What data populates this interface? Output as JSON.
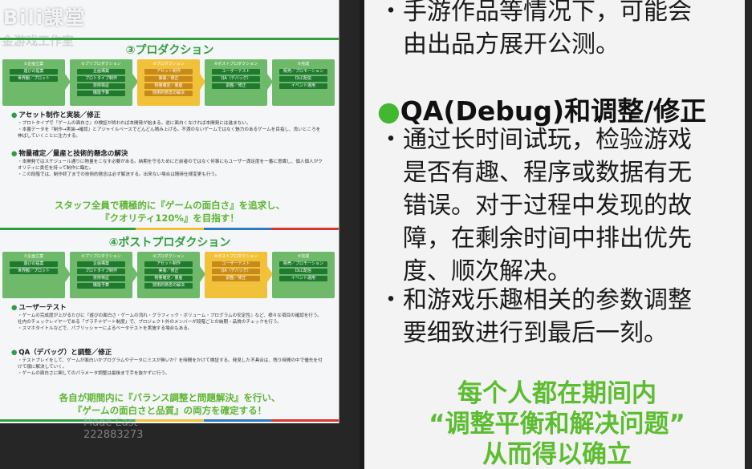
{
  "left_panel": {
    "watermark": "Bili課堂",
    "studio": "金游戏工作室",
    "section3": {
      "title": "③プロダクション",
      "stages": [
        {
          "header": "①企画立案",
          "pills": [
            "遊びの提案",
            "世界観／プロット"
          ]
        },
        {
          "header": "②プリプロダクション",
          "pills": [
            "企画構築",
            "プロトタイプ制作",
            "技術検証",
            "機能予算"
          ]
        },
        {
          "header": "③プロダクション",
          "pills": [
            "アセット制作",
            "実装／修正",
            "物量確定／量産",
            "技術的懸念の解決"
          ]
        },
        {
          "header": "④ポストプロダクション",
          "pills": [
            "ユーザーテスト",
            "QA（デバッグ）",
            "調整／修正"
          ]
        },
        {
          "header": "⑤完成",
          "pills": [
            "販売／プロモーション",
            "DLC配信",
            "イベント運用"
          ]
        }
      ],
      "h1": "アセット制作と実装／修正",
      "p1": [
        "プロトタイプで『ゲームの面白さ』の検証が終われば本開発が始まる。逆に面白くなければ本開発には進まない。",
        "本番データを『制作→実装→確認』とアジャイルベースでどんどん積み上げる。不満のないゲームではなく魅力のあるゲームを目指し、良いところを伸ばしていくことに注力する。"
      ],
      "h2": "物量確定／量産と技術的懸念の解決",
      "p2": [
        "本開発ではスケジュール通りに物量をこなす必要がある。納期を守るためにだ前者のではなく何事にもユーザー満足度を一番に意識し、個人個人がクオリティに責任を持って制作に臨む。",
        "この段階では、制作終了までの技術的懸念は必ず解決する。出来ない場合は随時仕様変更も行う。"
      ],
      "slogan_line1": "スタッフ全員で積極的に『ゲームの面白さ』を追求し、",
      "slogan_line2": "『クオリティ120%』を目指す！"
    },
    "section4": {
      "title": "④ポストプロダクション",
      "stages": [
        {
          "header": "①企画立案",
          "pills": [
            "遊びの提案",
            "世界観／プロット"
          ]
        },
        {
          "header": "②プリプロダクション",
          "pills": [
            "企画構築",
            "プロトタイプ制作",
            "技術検証",
            "機能予算"
          ]
        },
        {
          "header": "③プロダクション",
          "pills": [
            "アセット制作",
            "実装／修正",
            "物量確定／量産",
            "技術的懸念の解決"
          ]
        },
        {
          "header": "④ポストプロダクション",
          "pills": [
            "ユーザーテスト",
            "QA（デバッグ）",
            "調整／修正"
          ]
        },
        {
          "header": "⑤完成",
          "pills": [
            "販売／プロモーション",
            "DLC配信",
            "イベント運用"
          ]
        }
      ],
      "h1": "ユーザーテスト",
      "p1": [
        "ゲームの完成度が上がるたびに『遊びの面白さ・ゲームの流れ・グラフィック・ボリューム・プログラムの安定性』など、様々な項目の確認を行う。社内のチェックレイヤーである『プラチナゲート制度』で、プロジェクト外のメンバーが段階ごとの納期・品質のチェックを行う。",
        "スマホタイトルなどで、パブリッシャーによるベータテストを実施する場合もある。"
      ],
      "h2": "QA（デバッグ）と調整／修正",
      "p2": [
        "テストプレイをして、ゲームが面白いかプログラムやデータにミスが無いか？を時間をかけて検証する。発見した不具合は、残り時間の中で優先を付けて順に解決していく。",
        "ゲームの面白さに関してのパラメータ調整は最後まで手を抜かずに行う。"
      ],
      "slogan_line1": "各自が期間内に『バランス調整と問題解決』を行い、",
      "slogan_line2": "『ゲームの面白さと品質』の両方を確定する！"
    },
    "overlay_text": "Made East",
    "overlay_id": "222883273"
  },
  "right_panel": {
    "bullet0": [
      "手游作品等情况下，可能会",
      "由出品方展开公测。"
    ],
    "heading_mark": "●",
    "heading": "QA(Debug)和调整/修正",
    "bullet1": [
      "通过长时间试玩，检验游戏",
      "是否有趣、程序或数据有无",
      "错误。对于过程中发现的故",
      "障，在剩余时间中排出优先",
      "度、顺次解决。"
    ],
    "bullet2": [
      "和游戏乐趣相关的参数调整",
      "要细致进行到最后一刻。"
    ],
    "bullet_mark": "・",
    "slogan": [
      "每个人都在期间内",
      "“调整平衡和解决问题”",
      "从而得以确立"
    ]
  },
  "colors": {
    "green": "#2f9e3f",
    "yellow": "#f2c13a",
    "slogan_green": "#5cbd31"
  }
}
